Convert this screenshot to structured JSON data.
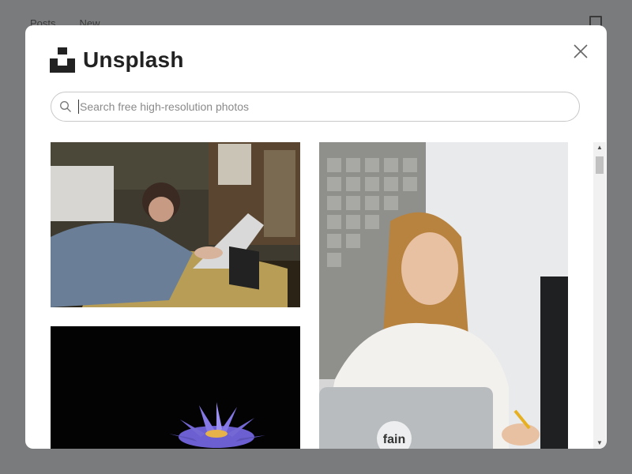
{
  "background": {
    "nav_items": [
      "Posts",
      "New"
    ]
  },
  "modal": {
    "brand_name": "Unsplash",
    "search": {
      "placeholder": "Search free high-resolution photos",
      "value": ""
    },
    "photos": [
      {
        "icon": "woman-video-call-photo"
      },
      {
        "icon": "purple-flower-photo"
      },
      {
        "icon": "woman-laptop-photo",
        "caption_on_laptop": "fain"
      }
    ]
  },
  "colors": {
    "overlay": "#7a7b7d",
    "modal_bg": "#ffffff",
    "text": "#222222",
    "border": "#c8c8c8"
  }
}
